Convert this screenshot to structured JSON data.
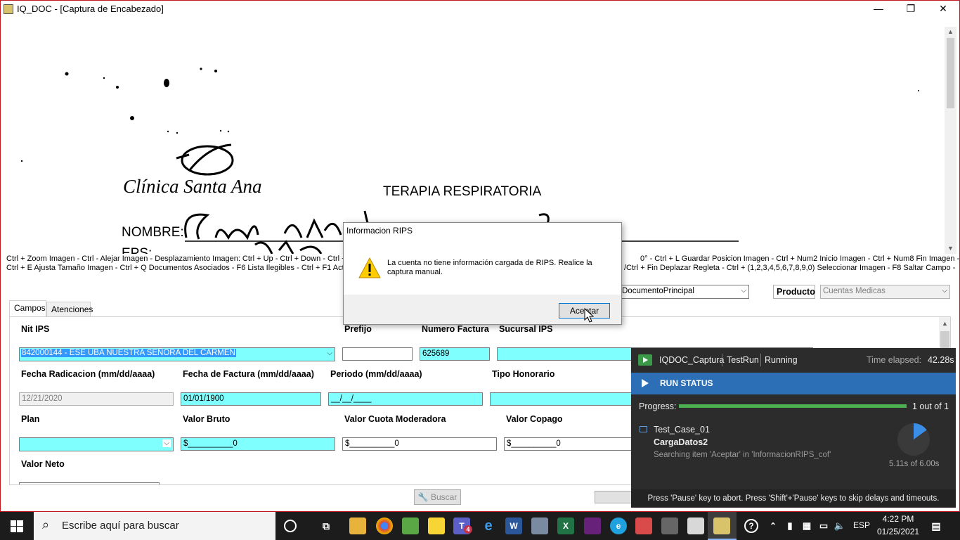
{
  "window": {
    "title": "IQ_DOC - [Captura de Encabezado]",
    "minimize": "—",
    "maximize": "❐",
    "close": "✕"
  },
  "document_image": {
    "clinic_name": "Clínica Santa Ana",
    "heading": "TERAPIA RESPIRATORIA",
    "nombre_label": "NOMBRE:",
    "eps_label": "EPS:"
  },
  "hints": {
    "line1": "Ctrl + Zoom Imagen - Ctrl - Alejar Imagen   - Desplazamiento Imagen: Ctrl + Up - Ctrl + Down - Ctrl + Le",
    "line1_right": "0°   - Ctrl + L Guardar Posicion Imagen      - Ctrl + Num2 Inicio Imagen - Ctrl + Num8 Fin Imagen -",
    "line2": "Ctrl + E Ajusta Tamaño Imagen    - Ctrl + Q Documentos Asociados - F6 Lista Ilegibles    - Ctrl + F1 Acti",
    "line2_right": "/Ctrl + Fin Deplazar Regleta    - Ctrl + (1,2,3,4,5,6,7,8,9,0) Seleccionar Imagen    - F8 Saltar Campo -"
  },
  "doc_type_combo": {
    "value": "DocumentoPrincipal"
  },
  "producto": {
    "label": "Producto",
    "value": "Cuentas Medicas"
  },
  "tabs": [
    {
      "label": "Campos"
    },
    {
      "label": "Atenciones"
    }
  ],
  "fields": {
    "nit_ips": {
      "label": "Nit IPS",
      "value": "842000144 - ESE UBA NUESTRA SEÑORA DEL CARMEN"
    },
    "prefijo": {
      "label": "Prefijo",
      "value": ""
    },
    "numero_factura": {
      "label": "Numero Factura",
      "value": "625689"
    },
    "sucursal_ips": {
      "label": "Sucursal IPS",
      "value": ""
    },
    "fecha_radicacion": {
      "label": "Fecha Radicacion (mm/dd/aaaa)",
      "value": "12/21/2020"
    },
    "fecha_factura": {
      "label": "Fecha de Factura (mm/dd/aaaa)",
      "value": "01/01/1900"
    },
    "periodo": {
      "label": "Periodo (mm/dd/aaaa)",
      "value": "__/__/____"
    },
    "tipo_honorario": {
      "label": "Tipo Honorario",
      "value": ""
    },
    "plan": {
      "label": "Plan",
      "value": ""
    },
    "valor_bruto": {
      "label": "Valor Bruto",
      "value": "$__________0"
    },
    "valor_cuota": {
      "label": "Valor Cuota Moderadora",
      "value": "$__________0"
    },
    "valor_copago": {
      "label": "Valor Copago",
      "value": "$__________0"
    },
    "valor_neto": {
      "label": "Valor Neto",
      "value": ""
    }
  },
  "buscar_button": {
    "label": "Buscar"
  },
  "dialog": {
    "title": "Informacion RIPS",
    "message": "La cuenta no tiene información cargada de RIPS. Realice la captura manual.",
    "ok_label": "Aceptar"
  },
  "ranorex": {
    "app": "IQDOC_Captura",
    "run": "TestRun",
    "state": "Running",
    "elapsed_label": "Time elapsed:",
    "elapsed": "42.28s",
    "status_title": "RUN STATUS",
    "progress_label": "Progress:",
    "progress_text": "1 out of 1",
    "progress_fraction": 1.0,
    "test_case": "Test_Case_01",
    "module": "CargaDatos2",
    "activity": "Searching item 'Aceptar' in 'InformacionRIPS_cof'",
    "timer": "5.11s of 6.00s",
    "timer_fraction": 0.85,
    "footer": "Press 'Pause' key to abort. Press 'Shift'+'Pause' keys to skip delays and timeouts."
  },
  "taskbar": {
    "search_placeholder": "Escribe aquí para buscar",
    "language": "ESP",
    "time": "4:22 PM",
    "date": "01/25/2021",
    "teams_badge": "4"
  },
  "colors": {
    "cyan_field": "#80ffff",
    "selection": "#3399ff",
    "ranorex_blue": "#2d6fb6",
    "progress_green": "#4caf50",
    "window_border": "#c0181f"
  }
}
